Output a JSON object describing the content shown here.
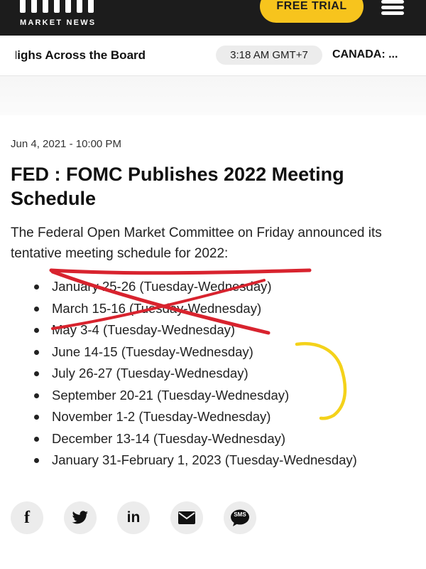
{
  "header": {
    "logo_text": "MARKET NEWS",
    "trial_label": "FREE TRIAL",
    "menu_icon": "hamburger-icon",
    "background": "#1c1c1c",
    "accent": "#f7c41d"
  },
  "ticker": {
    "headline": "Highs Across the Board",
    "time": "3:18 AM GMT+7",
    "country": "CANADA: ..."
  },
  "article": {
    "date": "Jun 4, 2021 - 10:00 PM",
    "title": "FED : FOMC Publishes 2022 Meeting Schedule",
    "intro": "The Federal Open Market Committee on Friday announced its tentative meeting schedule for 2022:",
    "meetings": [
      "January 25-26 (Tuesday-Wednesday)",
      "March 15-16 (Tuesday-Wednesday)",
      "May 3-4 (Tuesday-Wednesday)",
      "June 14-15 (Tuesday-Wednesday)",
      "July 26-27 (Tuesday-Wednesday)",
      "September 20-21 (Tuesday-Wednesday)",
      "November 1-2 (Tuesday-Wednesday)",
      "December 13-14 (Tuesday-Wednesday)",
      "January 31-February 1, 2023 (Tuesday-Wednesday)"
    ]
  },
  "annotations": {
    "strike_color": "#d8232e",
    "bracket_color": "#f4d21a",
    "crossed_out_items": 3
  },
  "share": {
    "facebook": "f",
    "twitter_icon": "twitter-icon",
    "linkedin": "in",
    "email_icon": "envelope-icon",
    "sms": "SMS"
  }
}
